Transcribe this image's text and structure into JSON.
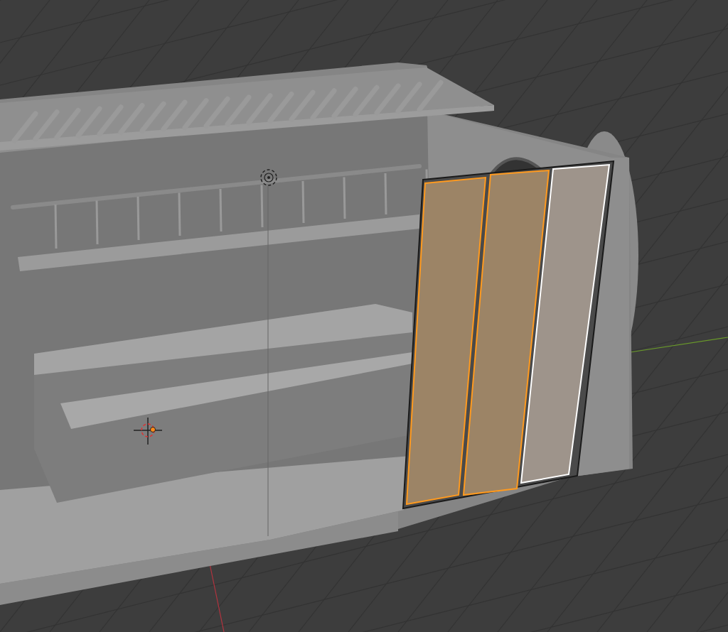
{
  "viewport": {
    "faces": [
      {
        "selected": true,
        "active": false
      },
      {
        "selected": true,
        "active": false
      },
      {
        "selected": true,
        "active": true
      }
    ]
  }
}
